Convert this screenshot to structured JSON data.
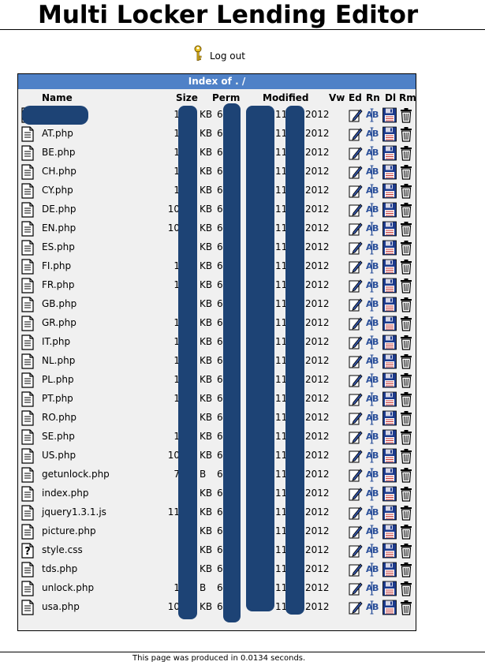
{
  "page": {
    "title": "Multi Locker Lending Editor",
    "logout_label": "Log out",
    "footer": "This page was produced in 0.0134 seconds."
  },
  "panel": {
    "header_prefix": "Index of ",
    "header_dot": ".",
    "header_slash": " /",
    "columns": {
      "name": "Name",
      "size": "Size",
      "perm": "Perm",
      "modified": "Modified",
      "vw": "Vw",
      "ed": "Ed",
      "rn": "Rn",
      "dl": "Dl",
      "rm": "Rm"
    },
    "rows": [
      {
        "name": "",
        "size": "1",
        "unit": "KB",
        "perm": "6",
        "mod1": "11",
        "mod2": "2012",
        "icon": "file-icon"
      },
      {
        "name": "AT.php",
        "size": "1",
        "unit": "KB",
        "perm": "6",
        "mod1": "11",
        "mod2": "2012",
        "icon": "file-icon"
      },
      {
        "name": "BE.php",
        "size": "1",
        "unit": "KB",
        "perm": "6",
        "mod1": "11",
        "mod2": "2012",
        "icon": "file-icon"
      },
      {
        "name": "CH.php",
        "size": "1",
        "unit": "KB",
        "perm": "6",
        "mod1": "11",
        "mod2": "2012",
        "icon": "file-icon"
      },
      {
        "name": "CY.php",
        "size": "1",
        "unit": "KB",
        "perm": "6",
        "mod1": "11",
        "mod2": "2012",
        "icon": "file-icon"
      },
      {
        "name": "DE.php",
        "size": "10",
        "unit": "KB",
        "perm": "6",
        "mod1": "11",
        "mod2": "2012",
        "icon": "file-icon"
      },
      {
        "name": "EN.php",
        "size": "10",
        "unit": "KB",
        "perm": "6",
        "mod1": "11",
        "mod2": "2012",
        "icon": "file-icon"
      },
      {
        "name": "ES.php",
        "size": "",
        "unit": "KB",
        "perm": "6",
        "mod1": "11",
        "mod2": "2012",
        "icon": "file-icon"
      },
      {
        "name": "FI.php",
        "size": "1",
        "unit": "KB",
        "perm": "6",
        "mod1": "11",
        "mod2": "2012",
        "icon": "file-icon"
      },
      {
        "name": "FR.php",
        "size": "1",
        "unit": "KB",
        "perm": "6",
        "mod1": "11",
        "mod2": "2012",
        "icon": "file-icon"
      },
      {
        "name": "GB.php",
        "size": "",
        "unit": "KB",
        "perm": "6",
        "mod1": "11",
        "mod2": "2012",
        "icon": "file-icon"
      },
      {
        "name": "GR.php",
        "size": "1",
        "unit": "KB",
        "perm": "6",
        "mod1": "11",
        "mod2": "2012",
        "icon": "file-icon"
      },
      {
        "name": "IT.php",
        "size": "1",
        "unit": "KB",
        "perm": "6",
        "mod1": "11",
        "mod2": "2012",
        "icon": "file-icon"
      },
      {
        "name": "NL.php",
        "size": "1",
        "unit": "KB",
        "perm": "6",
        "mod1": "11",
        "mod2": "2012",
        "icon": "file-icon"
      },
      {
        "name": "PL.php",
        "size": "1",
        "unit": "KB",
        "perm": "6",
        "mod1": "11",
        "mod2": "2012",
        "icon": "file-icon"
      },
      {
        "name": "PT.php",
        "size": "1",
        "unit": "KB",
        "perm": "6",
        "mod1": "11",
        "mod2": "2012",
        "icon": "file-icon"
      },
      {
        "name": "RO.php",
        "size": "",
        "unit": "KB",
        "perm": "6",
        "mod1": "11",
        "mod2": "2012",
        "icon": "file-icon"
      },
      {
        "name": "SE.php",
        "size": "1",
        "unit": "KB",
        "perm": "6",
        "mod1": "11",
        "mod2": "2012",
        "icon": "file-icon"
      },
      {
        "name": "US.php",
        "size": "10",
        "unit": "KB",
        "perm": "6",
        "mod1": "11",
        "mod2": "2012",
        "icon": "file-icon"
      },
      {
        "name": "getunlock.php",
        "size": "7",
        "unit": "B",
        "perm": "6",
        "mod1": "11",
        "mod2": "2012",
        "icon": "file-icon"
      },
      {
        "name": "index.php",
        "size": "",
        "unit": "KB",
        "perm": "6",
        "mod1": "11",
        "mod2": "2012",
        "icon": "file-icon"
      },
      {
        "name": "jquery1.3.1.js",
        "size": "11",
        "unit": "KB",
        "perm": "6",
        "mod1": "11",
        "mod2": "2012",
        "icon": "file-icon"
      },
      {
        "name": "picture.php",
        "size": "",
        "unit": "KB",
        "perm": "6",
        "mod1": "11",
        "mod2": "2012",
        "icon": "file-icon"
      },
      {
        "name": "style.css",
        "size": "",
        "unit": "KB",
        "perm": "6",
        "mod1": "11",
        "mod2": "2012",
        "icon": "unknown-file-icon"
      },
      {
        "name": "tds.php",
        "size": "",
        "unit": "KB",
        "perm": "6",
        "mod1": "11",
        "mod2": "2012",
        "icon": "file-icon"
      },
      {
        "name": "unlock.php",
        "size": "1",
        "unit": "B",
        "perm": "6",
        "mod1": "11",
        "mod2": "2012",
        "icon": "file-icon"
      },
      {
        "name": "usa.php",
        "size": "10",
        "unit": "KB",
        "perm": "6",
        "mod1": "11",
        "mod2": "2012",
        "icon": "file-icon"
      }
    ]
  },
  "icons": {
    "key": "key-icon",
    "edit": "edit-pencil-icon",
    "rename": "rename-ab-icon",
    "download": "floppy-disk-icon",
    "remove": "trash-can-icon"
  },
  "colors": {
    "header_bg": "#4f81c7",
    "panel_bg": "#f0f0f0",
    "redaction": "#1d4375"
  }
}
